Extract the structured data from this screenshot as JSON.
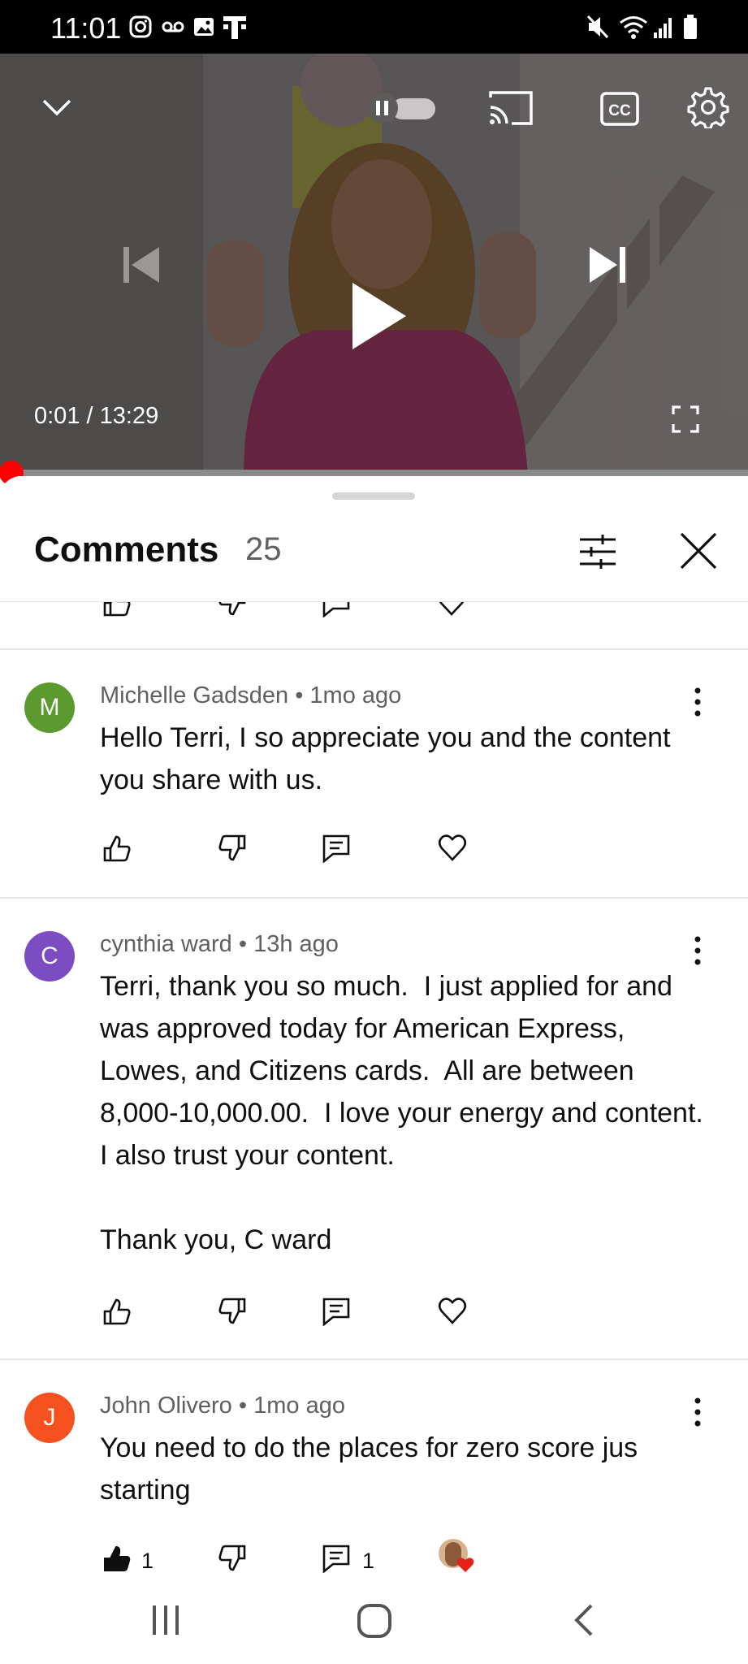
{
  "status_bar": {
    "time": "11:01"
  },
  "video": {
    "current_time": "0:01",
    "duration": "13:29",
    "progress": 0.0013,
    "autoplay_state": "paused"
  },
  "comments_panel": {
    "title": "Comments",
    "count": "25",
    "comments": [
      {
        "initial": "M",
        "avatar_color": "#5b9a2f",
        "author": "Michelle Gadsden",
        "age": "1mo ago",
        "text": "Hello Terri, I so appreciate you and the content you share with us."
      },
      {
        "initial": "C",
        "avatar_color": "#7b4cc2",
        "author": "cynthia ward",
        "age": "13h ago",
        "text": "Terri, thank you so much.  I just applied for and was approved today for American Express, Lowes, and Citizens cards.  All are between 8,000-10,000.00.  I love your energy and content.  I also trust your content.\n\nThank you, C ward"
      },
      {
        "initial": "J",
        "avatar_color": "#f4511e",
        "author": "John Olivero",
        "age": "1mo ago",
        "text": "You need to do the places for zero score jus starting",
        "like_count": "1",
        "reply_count": "1"
      }
    ]
  },
  "colors": {
    "accent_red": "#ff0000",
    "text_primary": "#0f0f0f",
    "text_secondary": "#606060"
  }
}
